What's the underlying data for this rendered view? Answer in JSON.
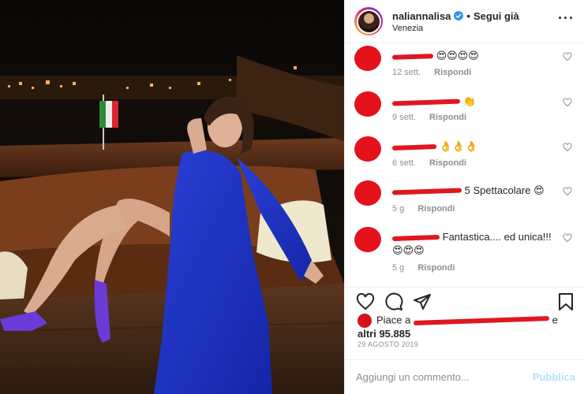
{
  "header": {
    "username": "naliannalisa",
    "separator": "•",
    "follow_label": "Segui già",
    "location": "Venezia"
  },
  "comments": [
    {
      "text_tail": "😍😍😍😍",
      "time": "12 sett.",
      "reply_label": "Rispondi"
    },
    {
      "text_tail": "👏",
      "time": "9 sett.",
      "reply_label": "Rispondi"
    },
    {
      "text_tail": "👌👌👌",
      "time": "6 sett.",
      "reply_label": "Rispondi"
    },
    {
      "text_tail": "5 Spettacolare 😍",
      "time": "5 g",
      "reply_label": "Rispondi"
    },
    {
      "text_tail": "Fantastica.... ed unica!!!",
      "text_line2": "😍😍😍",
      "time": "5 g",
      "reply_label": "Rispondi"
    }
  ],
  "likes": {
    "prefix": "Piace a",
    "suffix": "e",
    "count_text": "altri 95.885"
  },
  "date": "29 AGOSTO 2019",
  "add_comment": {
    "placeholder": "Aggiungi un commento...",
    "publish_label": "Pubblica"
  },
  "colors": {
    "accent_blue": "#0095f6",
    "publish_disabled": "#b2dffc",
    "redaction_red": "#e0171f",
    "verified_blue": "#3897f0"
  },
  "icons": [
    "more-options-icon",
    "verified-badge-icon",
    "like-icon",
    "comment-icon",
    "share-icon",
    "save-icon"
  ]
}
